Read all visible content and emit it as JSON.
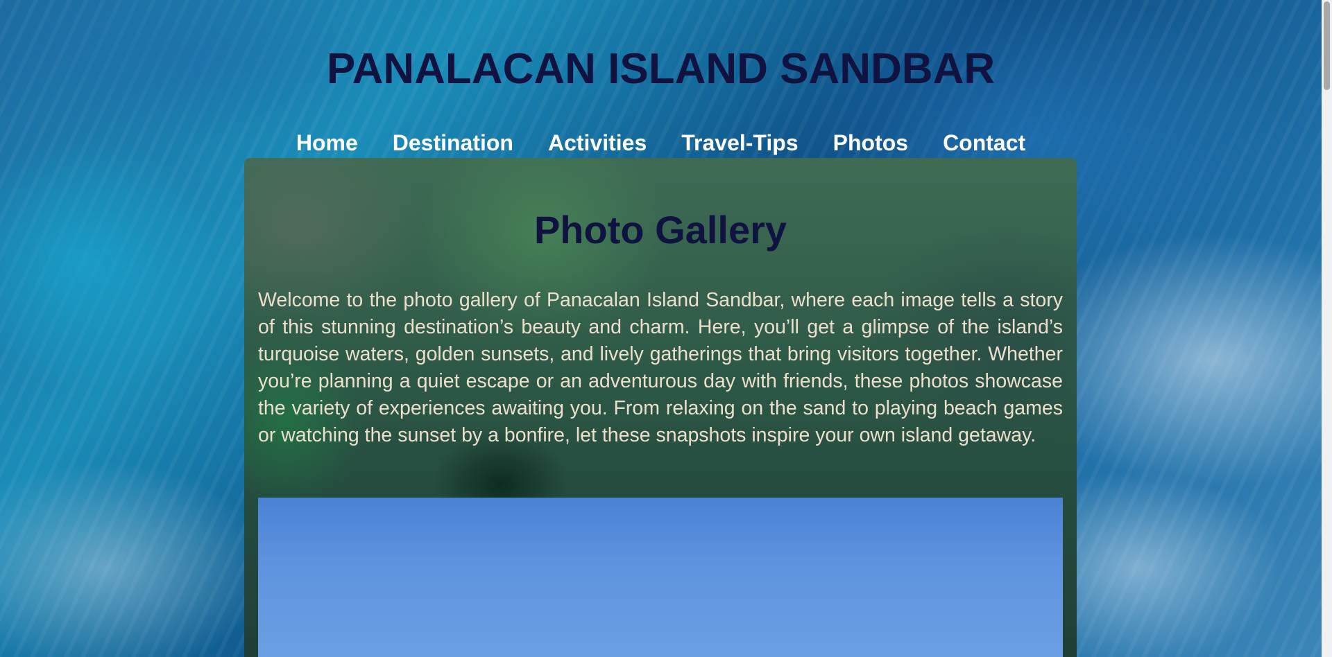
{
  "site": {
    "title": "PANALACAN ISLAND SANDBAR"
  },
  "nav": {
    "items": [
      {
        "label": "Home"
      },
      {
        "label": "Destination"
      },
      {
        "label": "Activities"
      },
      {
        "label": "Travel-Tips"
      },
      {
        "label": "Photos"
      },
      {
        "label": "Contact"
      }
    ]
  },
  "main": {
    "heading": "Photo Gallery",
    "intro": "Welcome to the photo gallery of Panacalan Island Sandbar, where each image tells a story of this stunning destination’s beauty and charm. Here, you’ll get a glimpse of the island’s turquoise waters, golden sunsets, and lively gatherings that bring visitors together. Whether you’re planning a quiet escape or an adventurous day with friends, these photos showcase the variety of experiences awaiting you. From relaxing on the sand to playing beach games or watching the sunset by a bonfire, let these snapshots inspire your own island getaway."
  },
  "colors": {
    "title": "#10123f",
    "nav_text": "#ffffff",
    "intro_text": "#eedfcd",
    "sky_photo": "#5e93df"
  }
}
